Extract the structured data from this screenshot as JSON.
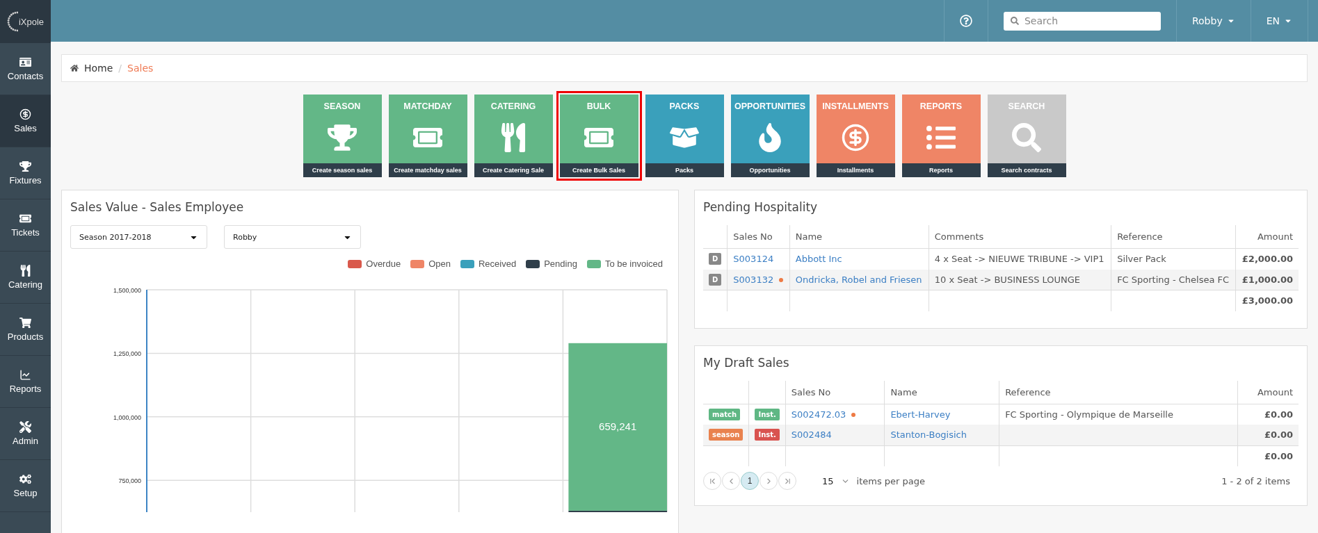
{
  "logo": {
    "text": "iXpole"
  },
  "topbar": {
    "search": {
      "placeholder": "Search"
    },
    "user": "Robby",
    "language": "EN"
  },
  "sidebar": {
    "items": [
      {
        "label": "Contacts",
        "selected": false
      },
      {
        "label": "Sales",
        "selected": true
      },
      {
        "label": "Fixtures",
        "selected": false
      },
      {
        "label": "Tickets",
        "selected": false
      },
      {
        "label": "Catering",
        "selected": false
      },
      {
        "label": "Products",
        "selected": false
      },
      {
        "label": "Reports",
        "selected": false
      },
      {
        "label": "Admin",
        "selected": false
      },
      {
        "label": "Setup",
        "selected": false
      }
    ]
  },
  "breadcrumb": {
    "separator": "/",
    "items": [
      {
        "label": "Home",
        "current": false
      },
      {
        "label": "Sales",
        "current": true
      }
    ]
  },
  "tiles": [
    {
      "title": "SEASON",
      "footer": "Create season sales",
      "color": "#63b787",
      "selected": false
    },
    {
      "title": "MATCHDAY",
      "footer": "Create matchday sales",
      "color": "#63b787",
      "selected": false
    },
    {
      "title": "CATERING",
      "footer": "Create Catering Sale",
      "color": "#63b787",
      "selected": false
    },
    {
      "title": "BULK",
      "footer": "Create Bulk Sales",
      "color": "#63b787",
      "selected": true
    },
    {
      "title": "PACKS",
      "footer": "Packs",
      "color": "#3aa0bb",
      "selected": false
    },
    {
      "title": "OPPORTUNITIES",
      "footer": "Opportunities",
      "color": "#3aa0bb",
      "selected": false
    },
    {
      "title": "INSTALLMENTS",
      "footer": "Installments",
      "color": "#ef8566",
      "selected": false
    },
    {
      "title": "REPORTS",
      "footer": "Reports",
      "color": "#ef8566",
      "selected": false
    },
    {
      "title": "SEARCH",
      "footer": "Search contracts",
      "color": "#c9c9c9",
      "selected": false
    }
  ],
  "sales_chart": {
    "title": "Sales Value - Sales Employee",
    "filters": [
      "Season 2017-2018",
      "Robby"
    ],
    "chart_data": {
      "type": "bar",
      "stacked": true,
      "grid": true,
      "ylim": [
        625000,
        1500000
      ],
      "yticks": [
        {
          "value": 750000,
          "label": "750,000"
        },
        {
          "value": 1000000,
          "label": "1,000,000"
        },
        {
          "value": 1250000,
          "label": "1,250,000"
        },
        {
          "value": 1500000,
          "label": "1,500,000"
        }
      ],
      "series": [
        {
          "name": "Overdue",
          "color": "#d9594c",
          "values": [
            null,
            null,
            null,
            null,
            null
          ]
        },
        {
          "name": "Open",
          "color": "#ef8566",
          "values": [
            null,
            null,
            null,
            null,
            null
          ]
        },
        {
          "name": "Received",
          "color": "#3aa0bb",
          "values": [
            null,
            null,
            null,
            null,
            null
          ]
        },
        {
          "name": "Pending",
          "color": "#2f3e4a",
          "values": [
            null,
            null,
            null,
            null,
            630759
          ]
        },
        {
          "name": "To be invoiced",
          "color": "#63b787",
          "values": [
            null,
            null,
            null,
            null,
            659241
          ],
          "value_labels": [
            null,
            null,
            null,
            null,
            "659,241"
          ]
        }
      ]
    }
  },
  "pending_hospitality": {
    "title": "Pending Hospitality",
    "columns": [
      "Sales No",
      "Name",
      "Comments",
      "Reference",
      "Amount"
    ],
    "rows": [
      {
        "badge": "D",
        "sales_no": "S003124",
        "flagged": false,
        "name": "Abbott Inc",
        "comments": "4 x Seat -> NIEUWE TRIBUNE -> VIP1",
        "reference": "Silver Pack",
        "amount": "£2,000.00"
      },
      {
        "badge": "D",
        "sales_no": "S003132",
        "flagged": true,
        "name": "Ondricka, Robel and Friesen",
        "comments": "10 x Seat -> BUSINESS LOUNGE",
        "reference": "FC Sporting - Chelsea FC",
        "amount": "£1,000.00"
      }
    ],
    "total": "£3,000.00"
  },
  "draft_sales": {
    "title": "My Draft Sales",
    "columns": [
      "Sales No",
      "Name",
      "Reference",
      "Amount"
    ],
    "rows": [
      {
        "type_tag": {
          "text": "match",
          "color": "#5fb784"
        },
        "inst_tag": {
          "text": "Inst.",
          "color": "#5fb784"
        },
        "sales_no": "S002472.03",
        "flagged": true,
        "name": "Ebert-Harvey",
        "reference": "FC Sporting - Olympique de Marseille",
        "amount": "£0.00"
      },
      {
        "type_tag": {
          "text": "season",
          "color": "#e9824e"
        },
        "inst_tag": {
          "text": "Inst.",
          "color": "#d9534f"
        },
        "sales_no": "S002484",
        "flagged": false,
        "name": "Stanton-Bogisich",
        "reference": "",
        "amount": "£0.00"
      }
    ],
    "total": "£0.00",
    "pager": {
      "pages": [
        {
          "label": "1",
          "selected": true
        }
      ],
      "per_page": "15",
      "per_page_label": "items per page",
      "summary": "1 - 2 of 2 items"
    }
  }
}
